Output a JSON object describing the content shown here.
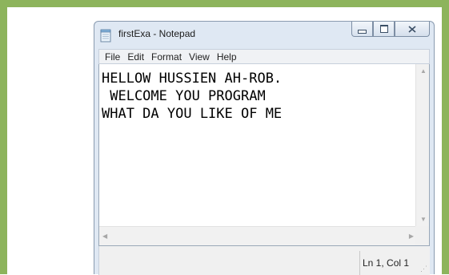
{
  "window": {
    "title": "firstExa - Notepad",
    "app_icon": "notepad-icon",
    "controls": {
      "minimize": "minimize-icon",
      "maximize": "maximize-icon",
      "close": "close-icon"
    }
  },
  "menu": [
    "File",
    "Edit",
    "Format",
    "View",
    "Help"
  ],
  "editor": {
    "content": "HELLOW HUSSIEN AH-ROB.\n WELCOME YOU PROGRAM\nWHAT DA YOU LIKE OF ME"
  },
  "status": {
    "position": "Ln 1, Col 1"
  },
  "colors": {
    "frame": "#8db45c",
    "title_bar": "#dfe8f3"
  }
}
